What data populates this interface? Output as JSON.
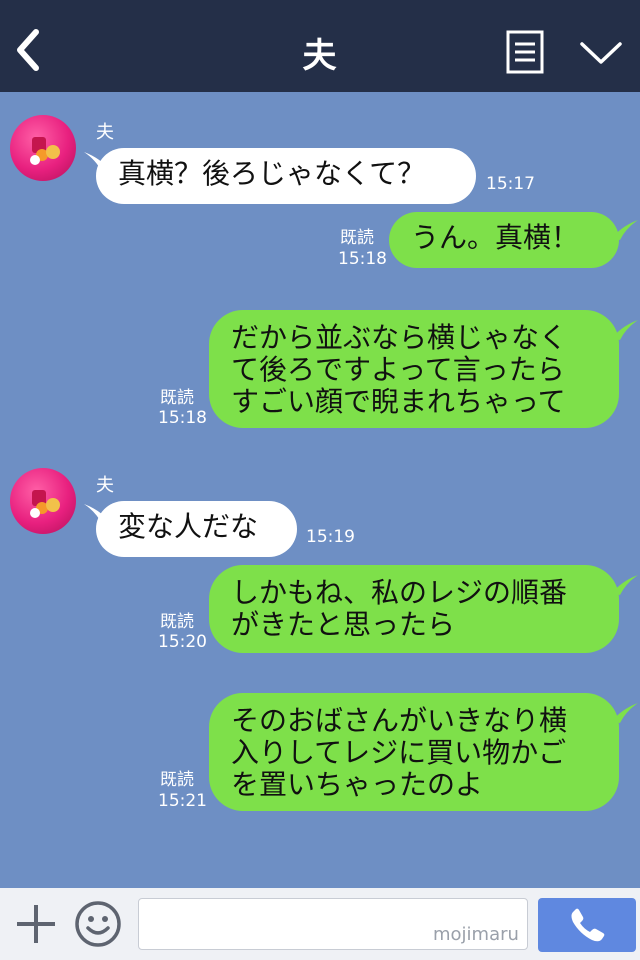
{
  "header": {
    "title": "夫",
    "back_icon": "chevron-left-icon",
    "menu_icon": "note-icon",
    "collapse_icon": "chevron-down-icon"
  },
  "messages": [
    {
      "side": "in",
      "sender": "夫",
      "lines": [
        "真横？後ろじゃなくて？"
      ],
      "time": "15:17"
    },
    {
      "side": "out",
      "read": "既読",
      "lines": [
        "うん。真横！"
      ],
      "time": "15:18"
    },
    {
      "side": "out",
      "read": "既読",
      "lines": [
        "だから並ぶなら横じゃなく",
        "て後ろですよって言ったら",
        "すごい顔で睨まれちゃって"
      ],
      "time": "15:18"
    },
    {
      "side": "in",
      "sender": "夫",
      "lines": [
        "変な人だな"
      ],
      "time": "15:19"
    },
    {
      "side": "out",
      "read": "既読",
      "lines": [
        "しかもね、私のレジの順番",
        "がきたと思ったら"
      ],
      "time": "15:20"
    },
    {
      "side": "out",
      "read": "既読",
      "lines": [
        "そのおばさんがいきなり横",
        "入りしてレジに買い物かご",
        "を置いちゃったのよ"
      ],
      "time": "15:21"
    }
  ],
  "footer": {
    "plus_icon": "plus-icon",
    "emoji_icon": "smiley-icon",
    "input_value": "",
    "watermark": "mojimaru",
    "call_icon": "phone-icon"
  },
  "colors": {
    "header_bg": "#242f48",
    "chat_bg": "#6e8fc4",
    "incoming_bubble": "#ffffff",
    "outgoing_bubble": "#7ee04a",
    "call_button": "#5f88e0"
  }
}
